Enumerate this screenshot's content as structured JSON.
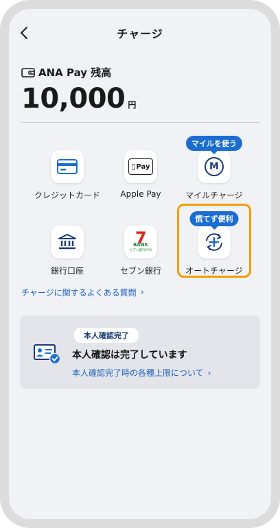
{
  "header": {
    "title": "チャージ",
    "back_icon": "chevron-left-icon"
  },
  "balance": {
    "label": "ANA Pay 残高",
    "amount": "10,000",
    "unit": "円",
    "icon": "wallet-icon"
  },
  "methods": [
    {
      "label": "クレジットカード",
      "icon": "credit-card-icon"
    },
    {
      "label": "Apple Pay",
      "icon": "apple-pay-icon",
      "icon_text": "Pay"
    },
    {
      "label": "マイルチャージ",
      "icon": "mile-icon",
      "icon_text": "M",
      "badge": "マイルを使う"
    },
    {
      "label": "銀行口座",
      "icon": "bank-icon"
    },
    {
      "label": "セブン銀行",
      "icon": "seven-bank-icon",
      "icon_text": "BANK",
      "icon_subtext": "セブン銀行ATM"
    },
    {
      "label": "オートチャージ",
      "icon": "auto-charge-icon",
      "badge": "慌てず便利",
      "highlight_color": "#f59c00"
    }
  ],
  "faq": {
    "label": "チャージに関するよくある質問",
    "chev": "›"
  },
  "verification": {
    "tag": "本人確認完了",
    "message": "本人確認は完了しています",
    "link": "本人確認完了時の各種上限について",
    "chev": "›",
    "icon": "id-card-check-icon"
  },
  "colors": {
    "accent": "#1b6dd1",
    "highlight": "#f59c00",
    "link": "#1b5fbd",
    "navy": "#1a3b73"
  }
}
